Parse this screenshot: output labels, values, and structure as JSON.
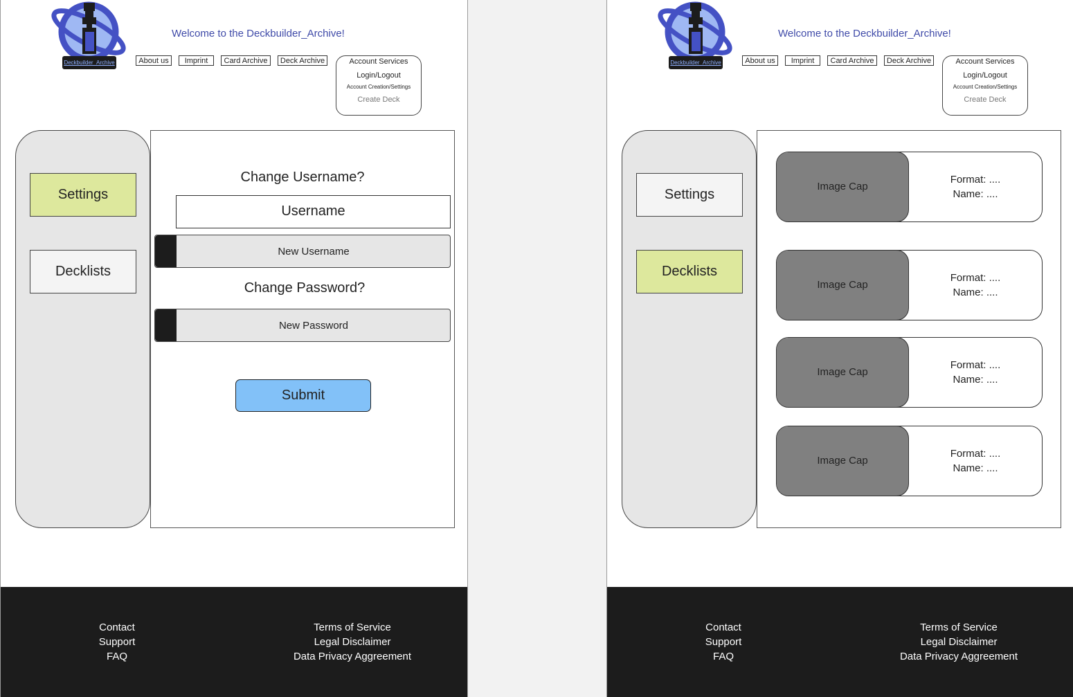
{
  "header": {
    "logo_text": "Deckbuilder_Archive",
    "welcome": "Welcome to the Deckbuilder_Archive!",
    "nav": [
      "About us",
      "Imprint",
      "Card Archive",
      "Deck Archive"
    ],
    "account": {
      "title": "Account Services",
      "login": "Login/Logout",
      "create": "Account Creation/Settings",
      "deck": "Create Deck"
    }
  },
  "sidebar": {
    "settings": "Settings",
    "decklists": "Decklists"
  },
  "settings_page": {
    "change_username": "Change Username?",
    "username_label": "Username",
    "new_username_placeholder": "New Username",
    "change_password": "Change Password?",
    "new_password_placeholder": "New Password",
    "submit": "Submit"
  },
  "decklist_page": {
    "decks": [
      {
        "image": "Image Cap",
        "format": "Format: ....",
        "name": "Name: ...."
      },
      {
        "image": "Image Cap",
        "format": "Format: ....",
        "name": "Name: ...."
      },
      {
        "image": "Image Cap",
        "format": "Format: ....",
        "name": "Name: ...."
      },
      {
        "image": "Image Cap",
        "format": "Format: ....",
        "name": "Name: ...."
      }
    ]
  },
  "footer": {
    "left": [
      "Contact",
      "Support",
      "FAQ"
    ],
    "right": [
      "Terms of Service",
      "Legal Disclaimer",
      "Data Privacy Aggreement"
    ]
  },
  "colors": {
    "active_tab": "#dde89d",
    "submit": "#82c1f8",
    "footer": "#1c1c1c",
    "logo_blue": "#4451c4"
  }
}
